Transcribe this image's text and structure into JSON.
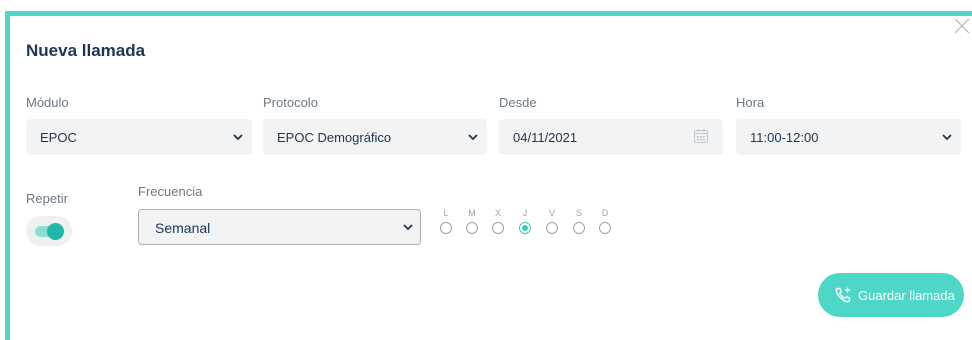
{
  "dialog": {
    "title": "Nueva llamada"
  },
  "fields": {
    "modulo": {
      "label": "Módulo",
      "value": "EPOC"
    },
    "protocolo": {
      "label": "Protocolo",
      "value": "EPOC Demográfico"
    },
    "desde": {
      "label": "Desde",
      "value": "04/11/2021"
    },
    "hora": {
      "label": "Hora",
      "value": "11:00-12:00"
    }
  },
  "repeat": {
    "label": "Repetir",
    "enabled": true
  },
  "frequency": {
    "label": "Frecuencia",
    "value": "Semanal"
  },
  "days": [
    {
      "letter": "L",
      "checked": false
    },
    {
      "letter": "M",
      "checked": false
    },
    {
      "letter": "X",
      "checked": false
    },
    {
      "letter": "J",
      "checked": true
    },
    {
      "letter": "V",
      "checked": false
    },
    {
      "letter": "S",
      "checked": false
    },
    {
      "letter": "D",
      "checked": false
    }
  ],
  "actions": {
    "save_label": "Guardar llamada"
  },
  "colors": {
    "accent": "#4ed6c6",
    "toggle_on": "#20b8a6",
    "text_dark": "#1d3651",
    "field_bg": "#f1f3f5"
  },
  "icons": {
    "close": "close-icon",
    "chevron": "chevron-down-icon",
    "calendar": "calendar-icon",
    "save": "phone-add-icon"
  }
}
